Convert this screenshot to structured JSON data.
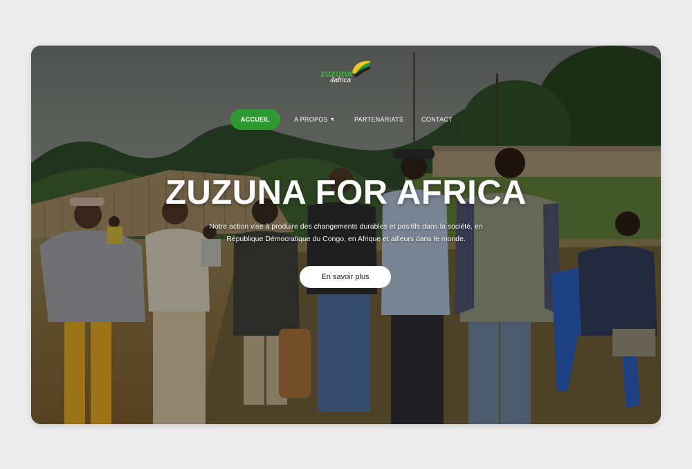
{
  "brand": {
    "logo_word": "zuzuna",
    "logo_sub": "4africa"
  },
  "nav": {
    "items": [
      {
        "label": "ACCUEIL",
        "active": true
      },
      {
        "label": "A PROPOS",
        "dropdown": true
      },
      {
        "label": "PARTENARIATS"
      },
      {
        "label": "CONTACT"
      }
    ]
  },
  "hero": {
    "title": "ZUZUNA FOR AFRICA",
    "subtitle": "Notre action vise à produire des changements durables et positifs dans la société, en République Démocratique du Congo, en Afrique et ailleurs dans le monde.",
    "cta_label": "En savoir plus"
  },
  "colors": {
    "accent": "#2f9a31",
    "page_bg": "#ededed",
    "text": "#ffffff"
  },
  "icons": {
    "dropdown": "caret-down-icon",
    "logo_mark": "leaf-icon"
  }
}
